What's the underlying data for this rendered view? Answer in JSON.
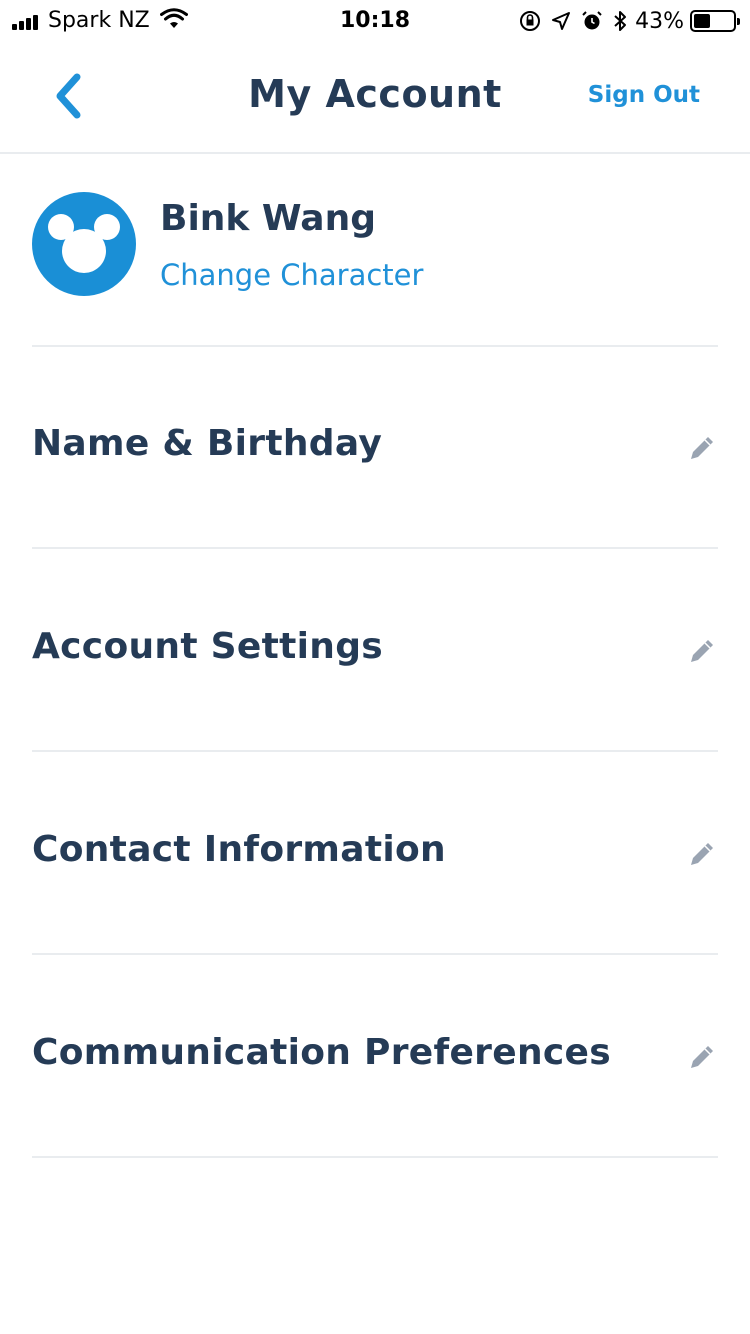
{
  "status_bar": {
    "carrier": "Spark NZ",
    "time": "10:18",
    "battery_percent": "43%",
    "battery_level": 0.43
  },
  "nav": {
    "title": "My Account",
    "sign_out_label": "Sign Out"
  },
  "profile": {
    "name": "Bink Wang",
    "change_character_label": "Change Character",
    "avatar_icon": "mickey-head-icon"
  },
  "rows": [
    {
      "label": "Name & Birthday",
      "icon": "pencil-icon"
    },
    {
      "label": "Account Settings",
      "icon": "pencil-icon"
    },
    {
      "label": "Contact Information",
      "icon": "pencil-icon"
    },
    {
      "label": "Communication Preferences",
      "icon": "pencil-icon"
    }
  ],
  "colors": {
    "primary_text": "#253b56",
    "accent": "#2091d8",
    "avatar_bg": "#1a8fd6",
    "edit_icon": "#9aa4b2",
    "divider": "#e9ecef"
  }
}
